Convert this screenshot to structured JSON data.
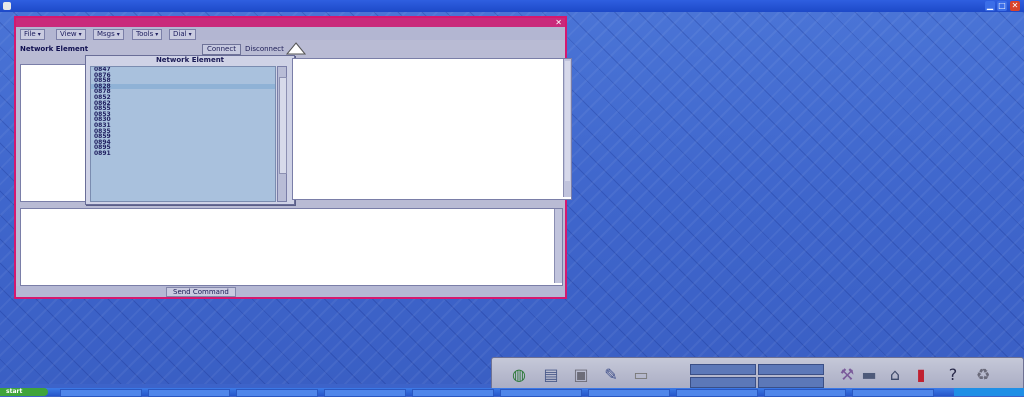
{
  "outer_window": {
    "title": "",
    "controls": [
      "minimize",
      "maximize",
      "close"
    ]
  },
  "app": {
    "title": "",
    "close_glyph": "✕",
    "menus": [
      {
        "label": "File",
        "arrow": "▾"
      },
      {
        "label": "View",
        "arrow": "▾"
      },
      {
        "label": "Msgs",
        "arrow": "▾"
      },
      {
        "label": "Tools",
        "arrow": "▾"
      },
      {
        "label": "Dial",
        "arrow": "▾"
      }
    ],
    "network_element": {
      "label": "Network Element",
      "value": "",
      "connect": "Connect",
      "disconnect": "Disconnect",
      "ne_ids": [
        "",
        ""
      ]
    },
    "response_area": {
      "label": "",
      "lines": [
        "",
        "",
        "",
        "",
        "",
        "",
        "",
        "",
        "",
        "",
        "",
        "",
        "",
        "",
        "",
        "",
        "",
        ""
      ]
    },
    "ne_popup": {
      "title": "Network Element",
      "items": [
        "0847",
        "0876",
        "0858",
        "0828",
        "0878",
        "0852",
        "0862",
        "0855",
        "0853",
        "0830",
        "0831",
        "0835",
        "0859",
        "0894",
        "0895",
        "0891"
      ],
      "selected_index": 3
    },
    "input_area": {
      "label": "",
      "hint": "",
      "left_lines": [
        "",
        "",
        "",
        "",
        "",
        "",
        "",
        "",
        "",
        "",
        "",
        "",
        "",
        ""
      ],
      "right_lines": [
        "",
        "",
        "",
        "",
        "",
        "",
        "",
        "",
        "",
        "",
        "",
        "",
        "",
        ""
      ]
    },
    "bottom_bar": {
      "send": "Send Command",
      "clear": "",
      "save": "",
      "multi": ""
    }
  },
  "dock": {
    "icons": [
      {
        "name": "globe-icon",
        "glyph": "◍",
        "color": "#2d7a3a"
      },
      {
        "name": "calendar-icon",
        "glyph": "▤",
        "color": "#4b5b8a"
      },
      {
        "name": "clipboard-icon",
        "glyph": "▣",
        "color": "#6c6c78"
      },
      {
        "name": "pen-icon",
        "glyph": "✎",
        "color": "#3f4f8a"
      },
      {
        "name": "folder-icon",
        "glyph": "▭",
        "color": "#777"
      },
      {
        "name": "tools-icon",
        "glyph": "⚒",
        "color": "#7a5a9a"
      },
      {
        "name": "drive-icon",
        "glyph": "▬",
        "color": "#4e5a7a"
      },
      {
        "name": "network-icon",
        "glyph": "⌂",
        "color": "#3e4a6a"
      },
      {
        "name": "colorbars-icon",
        "glyph": "▮",
        "color": "#c02030"
      },
      {
        "name": "help-icon",
        "glyph": "?",
        "color": "#2a2a4a"
      },
      {
        "name": "trash-icon",
        "glyph": "♻",
        "color": "#6a6a7a"
      }
    ],
    "fields": [
      "",
      "",
      "",
      ""
    ]
  },
  "taskbar": {
    "start": "start",
    "tasks": [
      "",
      "",
      "",
      "",
      "",
      "",
      "",
      "",
      "",
      ""
    ]
  }
}
